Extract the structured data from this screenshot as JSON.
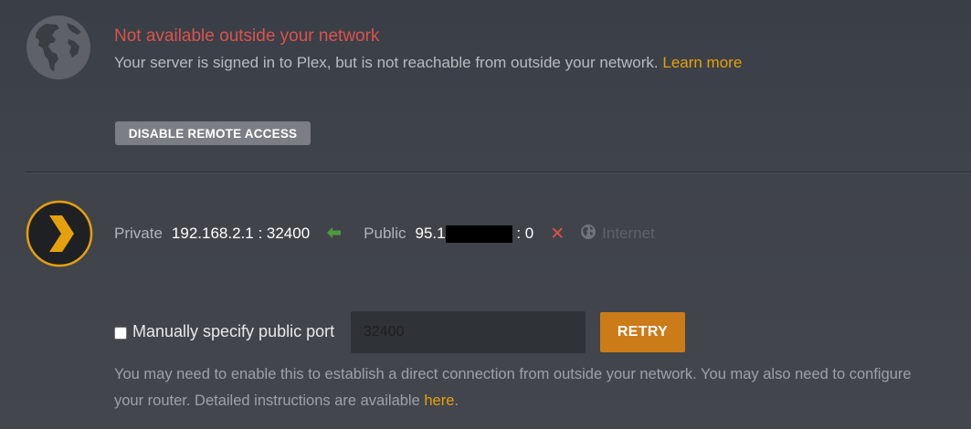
{
  "remote_access": {
    "status_title": "Not available outside your network",
    "status_message": "Your server is signed in to Plex, but is not reachable from outside your network.",
    "learn_more_link": "Learn more",
    "disable_button_label": "DISABLE REMOTE ACCESS",
    "status_color": "#d9534f",
    "link_color": "#e5a00d"
  },
  "connection": {
    "private_label": "Private",
    "private_address": "192.168.2.1 : 32400",
    "public_label": "Public",
    "public_address_prefix": "95.1",
    "public_port": ": 0",
    "internet_label": "Internet",
    "icons": {
      "logo": "plex-logo-icon",
      "private_to_public": "arrow-left-icon",
      "public_to_internet": "x-icon",
      "internet": "globe-icon"
    }
  },
  "manual_port": {
    "checkbox_label": "Manually specify public port",
    "checkbox_checked": false,
    "port_value": "32400",
    "retry_button_label": "RETRY",
    "help_text": "You may need to enable this to establish a direct connection from outside your network. You may also need to configure your router. Detailed instructions are available",
    "help_link": "here",
    "help_suffix": ".",
    "retry_color": "#cc7b19"
  }
}
